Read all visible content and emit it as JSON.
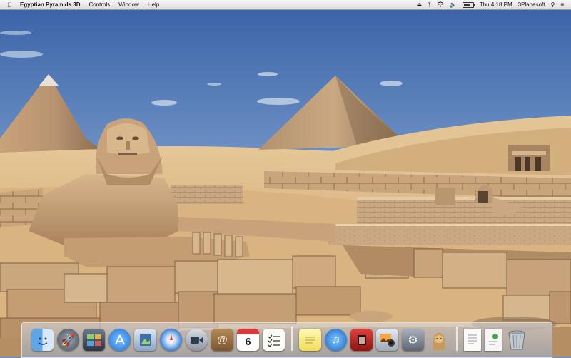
{
  "menubar": {
    "apple_icon": "apple-logo-icon",
    "app_name": "Egyptian Pyramids 3D",
    "menus": [
      "Controls",
      "Window",
      "Help"
    ],
    "clock": "Thu 4:18 PM",
    "user": "3Planesoft",
    "status_icons": [
      "eject-icon",
      "bluetooth-icon",
      "wifi-icon",
      "volume-icon",
      "battery-icon",
      "search-icon",
      "list-icon"
    ]
  },
  "dock": {
    "calendar_day": "6",
    "icons": [
      "finder-icon",
      "launchpad-icon",
      "mission-control-icon",
      "app-store-icon",
      "preview-icon",
      "safari-icon",
      "facetime-icon",
      "contacts-icon",
      "calendar-icon",
      "reminders-icon",
      "notes-icon",
      "itunes-icon",
      "photo-booth-icon",
      "iphoto-icon",
      "system-preferences-icon",
      "egyptian-pyramids-icon",
      "document-icon",
      "document-2-icon",
      "trash-icon"
    ]
  },
  "colors": {
    "sky_top": "#3c64a8",
    "sky_bottom": "#a6c2e2",
    "sand": "#dcb887",
    "stone": "#c9a47a"
  }
}
